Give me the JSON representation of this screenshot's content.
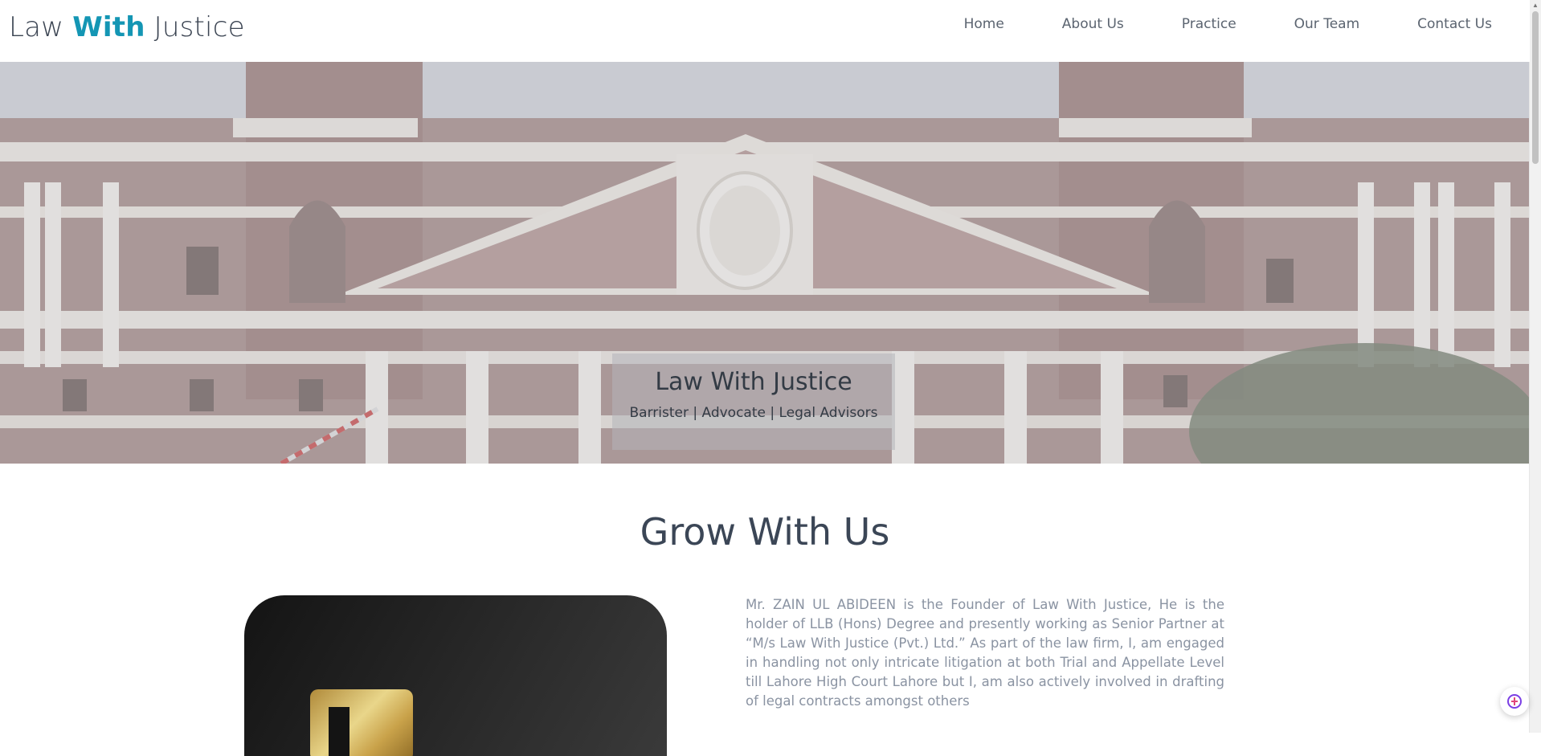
{
  "brand": {
    "part1": "Law ",
    "part2": "With",
    "part3": " Justice"
  },
  "nav": {
    "items": [
      {
        "label": "Home"
      },
      {
        "label": "About Us"
      },
      {
        "label": "Practice"
      },
      {
        "label": "Our Team"
      },
      {
        "label": "Contact Us"
      }
    ]
  },
  "hero": {
    "title": "Law With Justice",
    "subtitle": "Barrister | Advocate | Legal Advisors"
  },
  "section": {
    "title": "Grow With Us",
    "bio": "Mr. ZAIN UL ABIDEEN is the Founder of Law With Justice, He is the holder of LLB (Hons) Degree and presently working as Senior Partner at “M/s Law With Justice (Pvt.) Ltd.” As part of the law firm, I, am engaged in handling not only intricate litigation at both Trial and Appellate Level till Lahore High Court Lahore but I, am also actively involved in drafting of legal contracts amongst others"
  },
  "colors": {
    "accent": "#1496b4",
    "text": "#3b4656",
    "muted": "#8a93a2"
  }
}
